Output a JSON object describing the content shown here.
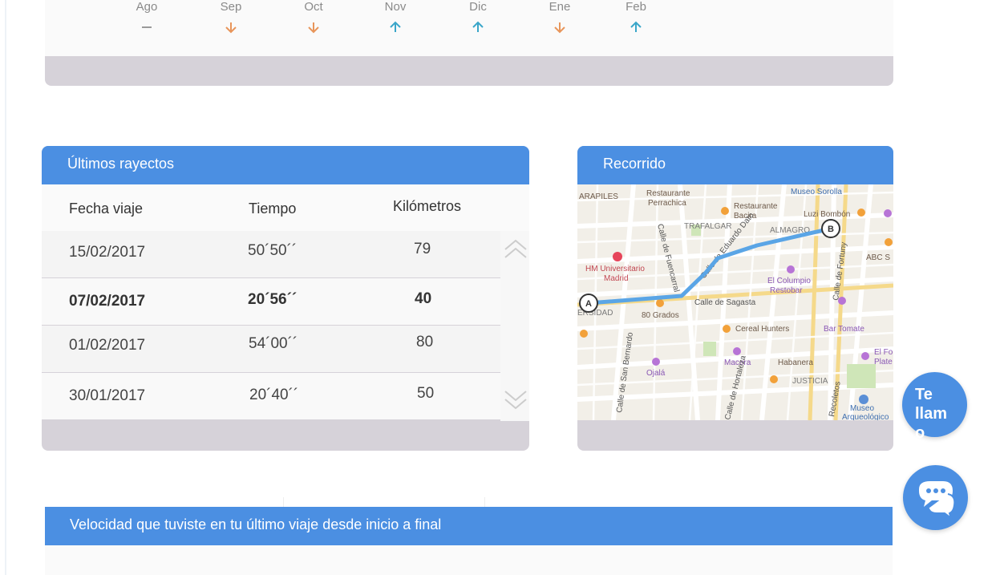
{
  "trend": {
    "months": [
      {
        "label": "Ago",
        "trend": "flat"
      },
      {
        "label": "Sep",
        "trend": "down"
      },
      {
        "label": "Oct",
        "trend": "down"
      },
      {
        "label": "Nov",
        "trend": "up"
      },
      {
        "label": "Dic",
        "trend": "up"
      },
      {
        "label": "Ene",
        "trend": "down"
      },
      {
        "label": "Feb",
        "trend": "up"
      }
    ],
    "colors": {
      "up": "#3aa6c9",
      "down": "#e8955a",
      "flat": "#9a9a9a"
    }
  },
  "trips": {
    "title": "Últimos rayectos",
    "columns": {
      "date": "Fecha viaje",
      "time": "Tiempo",
      "km": "Kilómetros"
    },
    "rows": [
      {
        "date": "15/02/2017",
        "time": "50´50´´",
        "km": "79"
      },
      {
        "date": "07/02/2017",
        "time": "20´56´´",
        "km": "40"
      },
      {
        "date": "01/02/2017",
        "time": "54´00´´",
        "km": "80"
      },
      {
        "date": "30/01/2017",
        "time": "20´40´´",
        "km": "50"
      }
    ]
  },
  "route": {
    "title": "Recorrido",
    "start_marker": "A",
    "end_marker": "B",
    "labels": {
      "l1": "ARAPILES",
      "l2": "Restaurante",
      "l3": "Perrachica",
      "l4": "Restaurante",
      "l5": "Bacira",
      "l6": "Museo Sorolla",
      "l7": "Luzi Bombón",
      "l8": "TRAFALGAR",
      "l9": "ALMAGRO",
      "l10": "HM Universitario",
      "l11": "Madrid",
      "l12": "El Columpio",
      "l13": "Restobar",
      "l14": "Calle de Sagasta",
      "l15": "80 Grados",
      "l16": "Cereal Hunters",
      "l17": "Bar Tomate",
      "l18": "ABC S",
      "l19": "ERSIDAD",
      "l20": "Ojalá",
      "l21": "Macera",
      "l22": "Habanera",
      "l23": "JUSTICIA",
      "l24": "El Fo",
      "l25": "Plate",
      "l26": "Museo",
      "l27": "Arqueológico",
      "l28": "Calle de San Bernardo",
      "l29": "Calle de Fuencarral",
      "l30": "Calle de Hortaleza",
      "l31": "Recoletos",
      "l32": "Calle de Fortuny",
      "l33": "Calle de Eduardo Dato"
    }
  },
  "speed": {
    "title": "Velocidad que tuviste en tu último viaje desde inicio a final"
  },
  "call": {
    "label": "Te llamo"
  }
}
